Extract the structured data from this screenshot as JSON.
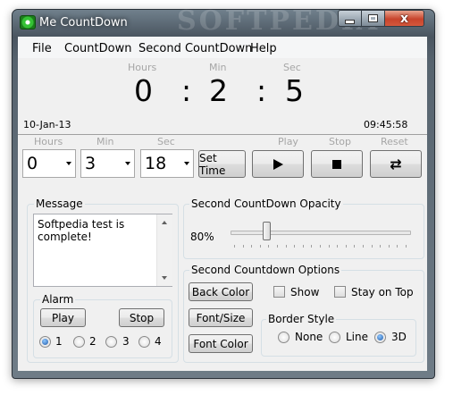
{
  "window": {
    "title": "Me CountDown",
    "watermark": "SOFTPEDIA",
    "minimize_label": "",
    "maximize_label": "",
    "close_label": "x"
  },
  "menu": {
    "items": [
      "File",
      "CountDown",
      "Second CountDown",
      "Help"
    ]
  },
  "display": {
    "hours_caption": "Hours",
    "minutes_caption": "Min",
    "seconds_caption": "Sec",
    "hours": "0",
    "minutes": "2",
    "seconds": "5",
    "separator": ":",
    "date": "10-Jan-13",
    "clock": "09:45:58"
  },
  "setter": {
    "hours_caption": "Hours",
    "minutes_caption": "Min",
    "seconds_caption": "Sec",
    "hours_value": "0",
    "minutes_value": "3",
    "seconds_value": "18",
    "set_time_label": "Set Time",
    "play_caption": "Play",
    "stop_caption": "Stop",
    "reset_caption": "Reset"
  },
  "message": {
    "group_title": "Message",
    "text": "Softpedia test is complete!"
  },
  "alarm": {
    "group_title": "Alarm",
    "play_label": "Play",
    "stop_label": "Stop",
    "options": [
      "1",
      "2",
      "3",
      "4"
    ],
    "selected": "1"
  },
  "opacity": {
    "group_title": "Second CountDown Opacity",
    "value_label": "80%",
    "value": 0.8
  },
  "options": {
    "group_title": "Second Countdown Options",
    "back_color_label": "Back Color",
    "font_size_label": "Font/Size",
    "font_color_label": "Font Color",
    "show_label": "Show",
    "stay_on_top_label": "Stay on Top",
    "show_checked": false,
    "stay_on_top_checked": false
  },
  "border_style": {
    "group_title": "Border Style",
    "options": [
      "None",
      "Line",
      "3D"
    ],
    "selected": "3D"
  },
  "colors": {
    "frame": "#56636e",
    "client_bg": "#f0f0f0",
    "caption_gray": "#a6a6a6",
    "close_red": "#c8442c"
  }
}
